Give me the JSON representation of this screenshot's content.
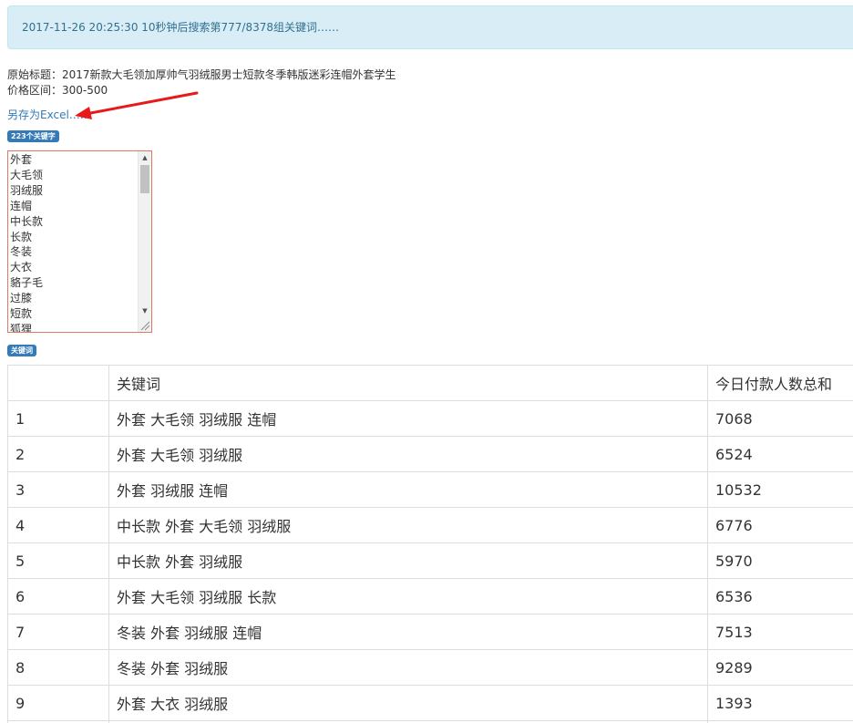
{
  "alert": {
    "text": "2017-11-26 20:25:30 10秒钟后搜索第777/8378组关键词……"
  },
  "info": {
    "original_title": "原始标题：2017新款大毛领加厚帅气羽绒服男士短款冬季韩版迷彩连帽外套学生",
    "price_range": "价格区间：300-500"
  },
  "save_link": "另存为Excel……",
  "keyword_count_badge": "223个关键字",
  "keyword_list": [
    "外套",
    "大毛领",
    "羽绒服",
    "连帽",
    "中长款",
    "长款",
    "冬装",
    "大衣",
    "貉子毛",
    "过膝",
    "短款",
    "狐狸"
  ],
  "keywords_badge": "关键词",
  "table": {
    "headers": [
      "",
      "关键词",
      "今日付款人数总和"
    ],
    "rows": [
      {
        "index": "1",
        "keywords": "外套 大毛领 羽绒服 连帽",
        "total": "7068"
      },
      {
        "index": "2",
        "keywords": "外套 大毛领 羽绒服",
        "total": "6524"
      },
      {
        "index": "3",
        "keywords": "外套 羽绒服 连帽",
        "total": "10532"
      },
      {
        "index": "4",
        "keywords": "中长款 外套 大毛领 羽绒服",
        "total": "6776"
      },
      {
        "index": "5",
        "keywords": "中长款 外套 羽绒服",
        "total": "5970"
      },
      {
        "index": "6",
        "keywords": "外套 大毛领 羽绒服 长款",
        "total": "6536"
      },
      {
        "index": "7",
        "keywords": "冬装 外套 羽绒服 连帽",
        "total": "7513"
      },
      {
        "index": "8",
        "keywords": "冬装 外套 羽绒服",
        "total": "9289"
      },
      {
        "index": "9",
        "keywords": "外套 大衣 羽绒服",
        "total": "1393"
      },
      {
        "index": "",
        "keywords": "",
        "total": ""
      }
    ]
  },
  "colors": {
    "alert_bg": "#d9edf7",
    "alert_text": "#31708f",
    "link": "#337ab7",
    "badge": "#337ab7",
    "arrow": "#e8191b",
    "listbox_border": "#e07a5f"
  }
}
